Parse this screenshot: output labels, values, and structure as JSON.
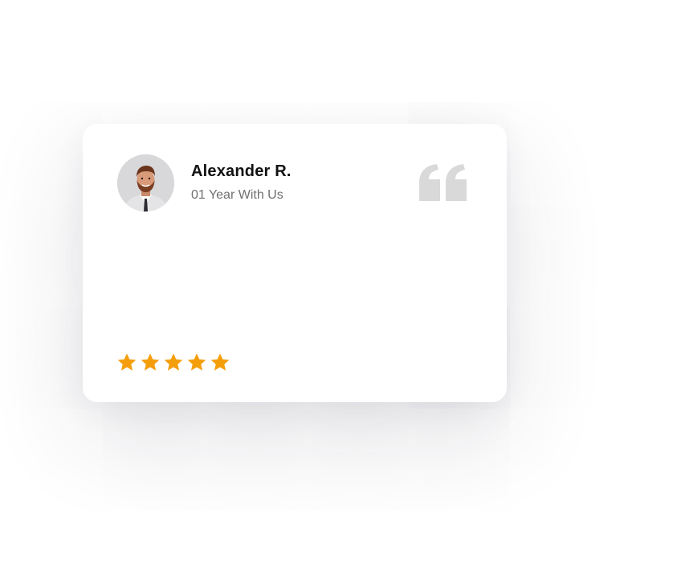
{
  "testimonial": {
    "name": "Alexander R.",
    "subtitle": "01 Year With Us",
    "rating": 5,
    "rating_max": 5
  },
  "icons": {
    "quote": "quote-icon",
    "star": "star-icon",
    "avatar": "avatar"
  },
  "colors": {
    "star": "#F59E0B",
    "quote": "#D9D9D9",
    "name": "#111111",
    "subtitle": "#6F6F6F"
  }
}
